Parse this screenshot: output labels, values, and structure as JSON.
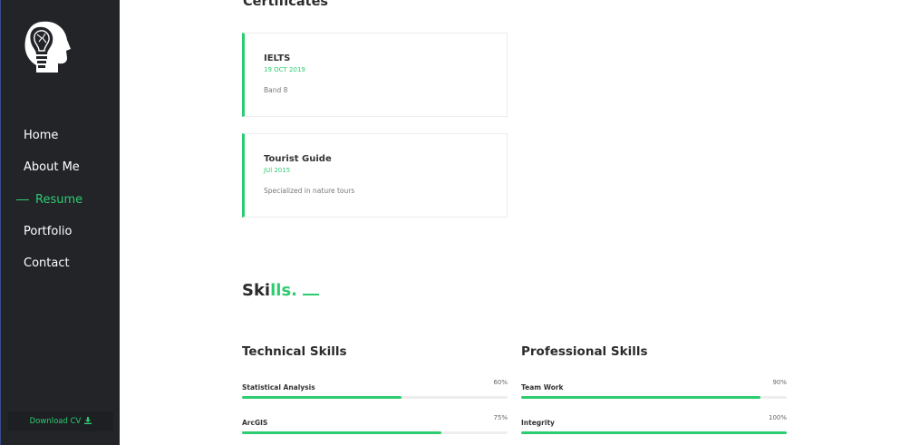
{
  "sidebar": {
    "logo_icon": "head-bulb-brain-icon",
    "nav": [
      {
        "label": "Home",
        "active": false
      },
      {
        "label": "About Me",
        "active": false
      },
      {
        "label": "Resume",
        "active": true
      },
      {
        "label": "Portfolio",
        "active": false
      },
      {
        "label": "Contact",
        "active": false
      }
    ],
    "download_label": "Download CV",
    "download_icon": "download-icon"
  },
  "certificates": {
    "heading": "Certificates",
    "items": [
      {
        "title": "IELTS",
        "date": "19 OCT 2019",
        "description": "Band 8"
      },
      {
        "title": "Tourist Guide",
        "date": "JUl 2015",
        "description": "Specialized in nature tours"
      }
    ]
  },
  "skills": {
    "title_part1": "Ski",
    "title_part2": "lls.",
    "technical": {
      "heading": "Technical Skills",
      "items": [
        {
          "name": "Statistical Analysis",
          "percent_label": "60%",
          "level": 60
        },
        {
          "name": "ArcGIS",
          "percent_label": "75%",
          "level": 75
        }
      ]
    },
    "professional": {
      "heading": "Professional Skills",
      "items": [
        {
          "name": "Team Work",
          "percent_label": "90%",
          "level": 90
        },
        {
          "name": "Integrity",
          "percent_label": "100%",
          "level": 100
        }
      ]
    }
  },
  "colors": {
    "accent": "#2ecc71",
    "sidebar_bg": "#222428"
  }
}
